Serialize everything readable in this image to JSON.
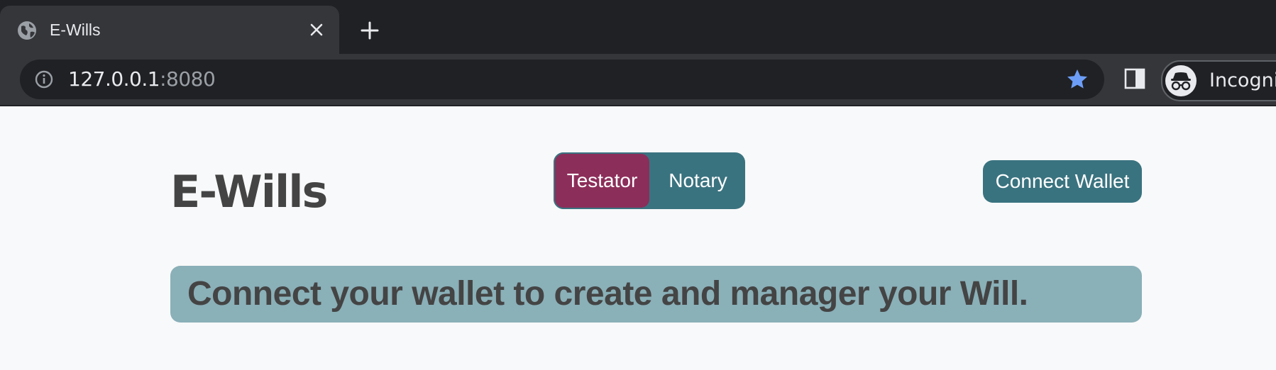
{
  "browser": {
    "tab": {
      "title": "E-Wills",
      "favicon": "globe-icon",
      "close_icon": "close-icon"
    },
    "new_tab_icon": "plus-icon",
    "address_bar": {
      "info_icon": "info-icon",
      "host": "127.0.0.1",
      "port": ":8080",
      "bookmark_icon": "star-icon",
      "bookmark_color": "#6c9ef8"
    },
    "side_panel_icon": "side-panel-icon",
    "profile": {
      "icon": "incognito-icon",
      "label": "Incognito"
    }
  },
  "page": {
    "brand": "E-Wills",
    "role_switch": {
      "options": [
        "Testator",
        "Notary"
      ],
      "selected": "Testator",
      "active_color": "#8c2e5a",
      "inactive_color": "#3a7380"
    },
    "connect_button": "Connect Wallet",
    "banner": {
      "text": "Connect your wallet to create and manager your Will.",
      "background": "#8ab0b8"
    }
  }
}
